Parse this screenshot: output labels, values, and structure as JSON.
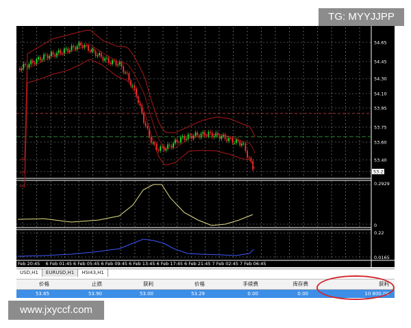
{
  "watermarks": {
    "top_right": "TG: MYYJJPP",
    "bottom_left": "www.jxyccf.com"
  },
  "colors": {
    "bullish_candle": "#2ee02e",
    "bearish_candle": "#ff3030",
    "bollinger_band": "#b01818",
    "oscillator_line": "#e8e28a",
    "volume_line": "#3f58ff",
    "chart_background": "#000000",
    "selected_row": "#3d8ee6",
    "highlight_ellipse": "#d4262b"
  },
  "price_axis": [
    "54.65",
    "54.45",
    "54.30",
    "54.10",
    "53.95",
    "53.75",
    "53.60",
    "53.40",
    "53.27"
  ],
  "current_price": "53.27",
  "indicator_axis": {
    "top": "0.2929",
    "bottom": "0"
  },
  "volume_axis": {
    "top": "0.22",
    "bottom": "0.0165"
  },
  "time_axis": [
    "Feb 20:45",
    "6 Feb 01:45",
    "6 Feb 05:45",
    "6 Feb 09:45",
    "6 Feb 13:45",
    "6 Feb 17:45",
    "6 Feb 21:45",
    "7 Feb 02:45",
    "7 Feb 06:45"
  ],
  "tabs": [
    "USD,H1",
    "EURUSD,H1",
    "HSI43,H1"
  ],
  "trade_table": {
    "headers": [
      "价格",
      "止损",
      "获利",
      "价格",
      "手续费",
      "库存费",
      "获利"
    ],
    "row": [
      "53.65",
      "53.90",
      "53.00",
      "53.29",
      "0.00",
      "0.00",
      "10 800.00"
    ]
  }
}
